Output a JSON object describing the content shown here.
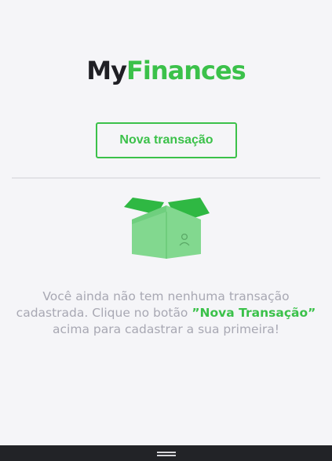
{
  "logo": {
    "part_a": "My",
    "part_b": "Finances"
  },
  "actions": {
    "new_transaction_label": "Nova transação"
  },
  "empty_state": {
    "illustration_icon": "open-box-icon",
    "text_before": "Você ainda não tem nenhuma transação cadastrada. Clique no botão ",
    "highlight": "”Nova Transação”",
    "text_after": " acima para cadastrar a sua primeira!"
  },
  "system_nav": {
    "icon": "home-handle-icon"
  },
  "colors": {
    "brand_green": "#3bc14a",
    "text_dark": "#1f1f24",
    "text_muted": "#a8a8b3",
    "background": "#f5f5f8",
    "nav_bar": "#222327"
  }
}
